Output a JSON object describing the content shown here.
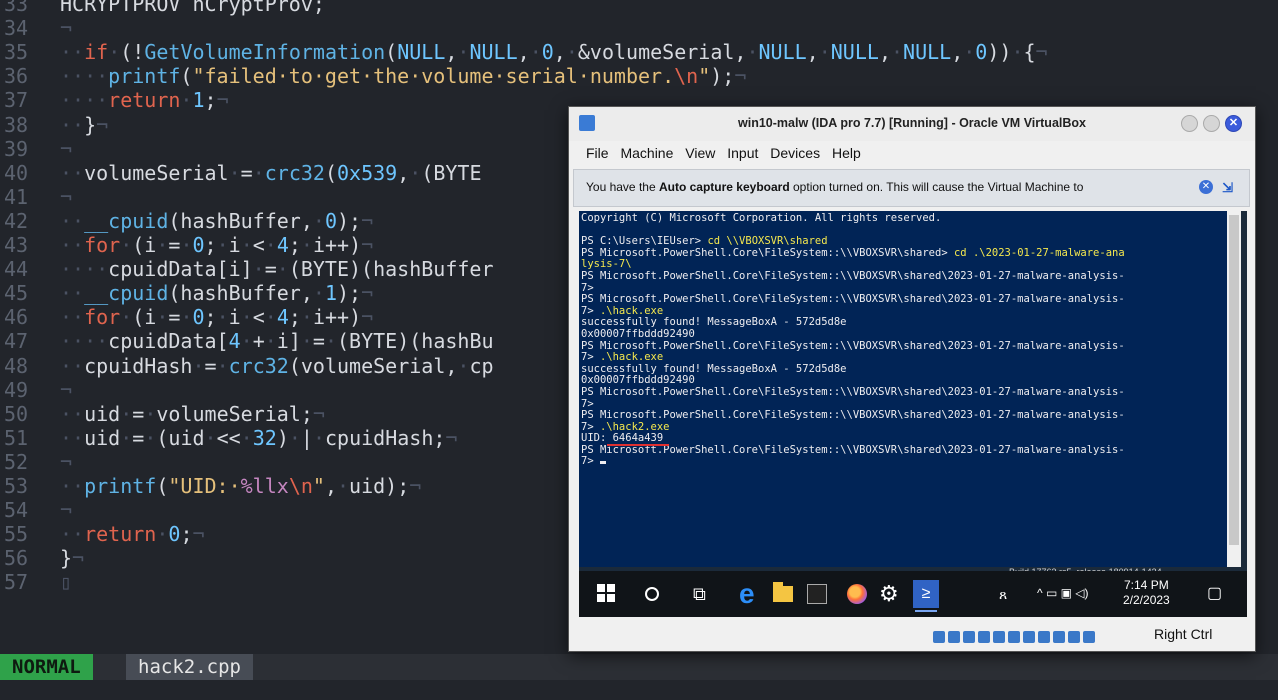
{
  "editor": {
    "lines": [
      {
        "num": "33",
        "html": "HCRYPTPROV hCryptProv;"
      },
      {
        "num": "34",
        "html": "<span class='w'>¬</span>"
      },
      {
        "num": "35",
        "html": "<span class='w'>··</span><span class='k'>if</span><span class='w'>·</span>(!<span class='f'>GetVolumeInformation</span>(<span class='n'>NULL</span>,<span class='w'>·</span><span class='n'>NULL</span>,<span class='w'>·</span><span class='n'>0</span>,<span class='w'>·</span>&volumeSerial,<span class='w'>·</span><span class='n'>NULL</span>,<span class='w'>·</span><span class='n'>NULL</span>,<span class='w'>·</span><span class='n'>NULL</span>,<span class='w'>·</span><span class='n'>0</span>))<span class='w'>·</span>{<span class='w'>¬</span>"
      },
      {
        "num": "36",
        "html": "<span class='w'>····</span><span class='f'>printf</span>(<span class='s'>\"failed·to·get·the·volume·serial·number.</span><span class='k'>\\n</span><span class='s'>\"</span>);<span class='w'>¬</span>"
      },
      {
        "num": "37",
        "html": "<span class='w'>····</span><span class='k'>return</span><span class='w'>·</span><span class='n'>1</span>;<span class='w'>¬</span>"
      },
      {
        "num": "38",
        "html": "<span class='w'>··</span>}<span class='w'>¬</span>"
      },
      {
        "num": "39",
        "html": "<span class='w'>¬</span>"
      },
      {
        "num": "40",
        "html": "<span class='w'>··</span>volumeSerial<span class='w'>·</span>=<span class='w'>·</span><span class='f'>crc32</span>(<span class='n'>0x539</span>,<span class='w'>·</span>(BYTE"
      },
      {
        "num": "41",
        "html": "<span class='w'>¬</span>"
      },
      {
        "num": "42",
        "html": "<span class='w'>··</span><span class='f'>__cpuid</span>(hashBuffer,<span class='w'>·</span><span class='n'>0</span>);<span class='w'>¬</span>"
      },
      {
        "num": "43",
        "html": "<span class='w'>··</span><span class='k'>for</span><span class='w'>·</span>(i<span class='w'>·</span>=<span class='w'>·</span><span class='n'>0</span>;<span class='w'>·</span>i<span class='w'>·</span>&lt;<span class='w'>·</span><span class='n'>4</span>;<span class='w'>·</span>i++)<span class='w'>¬</span>"
      },
      {
        "num": "44",
        "html": "<span class='w'>····</span>cpuidData[i]<span class='w'>·</span>=<span class='w'>·</span>(BYTE)(hashBuffer"
      },
      {
        "num": "45",
        "html": "<span class='w'>··</span><span class='f'>__cpuid</span>(hashBuffer,<span class='w'>·</span><span class='n'>1</span>);<span class='w'>¬</span>"
      },
      {
        "num": "46",
        "html": "<span class='w'>··</span><span class='k'>for</span><span class='w'>·</span>(i<span class='w'>·</span>=<span class='w'>·</span><span class='n'>0</span>;<span class='w'>·</span>i<span class='w'>·</span>&lt;<span class='w'>·</span><span class='n'>4</span>;<span class='w'>·</span>i++)<span class='w'>¬</span>"
      },
      {
        "num": "47",
        "html": "<span class='w'>····</span>cpuidData[<span class='n'>4</span><span class='w'>·</span>+<span class='w'>·</span>i]<span class='w'>·</span>=<span class='w'>·</span>(BYTE)(hashBu"
      },
      {
        "num": "48",
        "html": "<span class='w'>··</span>cpuidHash<span class='w'>·</span>=<span class='w'>·</span><span class='f'>crc32</span>(volumeSerial,<span class='w'>·</span>cp"
      },
      {
        "num": "49",
        "html": "<span class='w'>¬</span>"
      },
      {
        "num": "50",
        "html": "<span class='w'>··</span>uid<span class='w'>·</span>=<span class='w'>·</span>volumeSerial;<span class='w'>¬</span>"
      },
      {
        "num": "51",
        "html": "<span class='w'>··</span>uid<span class='w'>·</span>=<span class='w'>·</span>(uid<span class='w'>·</span>&lt;&lt;<span class='w'>·</span><span class='n'>32</span>)<span class='w'>·</span>|<span class='w'>·</span>cpuidHash;<span class='w'>¬</span>"
      },
      {
        "num": "52",
        "html": "<span class='w'>¬</span>"
      },
      {
        "num": "53",
        "html": "<span class='w'>··</span><span class='f'>printf</span>(<span class='s'>\"UID:·</span><span class='pu'>%llx</span><span class='k'>\\n</span><span class='s'>\"</span>,<span class='w'>·</span>uid);<span class='w'>¬</span>"
      },
      {
        "num": "54",
        "html": "<span class='w'>¬</span>"
      },
      {
        "num": "55",
        "html": "<span class='w'>··</span><span class='k'>return</span><span class='w'>·</span><span class='n'>0</span>;<span class='w'>¬</span>"
      },
      {
        "num": "56",
        "html": "}<span class='w'>¬</span>"
      },
      {
        "num": "57",
        "html": "<span class='w'>▯</span>"
      }
    ],
    "mode": "NORMAL",
    "filename": "hack2.cpp"
  },
  "vbox": {
    "title": "win10-malw (IDA pro 7.7) [Running] - Oracle VM VirtualBox",
    "menu": [
      "File",
      "Machine",
      "View",
      "Input",
      "Devices",
      "Help"
    ],
    "notice_pre": "You have the ",
    "notice_bold": "Auto capture keyboard",
    "notice_post": " option turned on. This will cause the Virtual Machine to",
    "host_key": "Right Ctrl"
  },
  "powershell": {
    "lines": [
      "Copyright (C) Microsoft Corporation. All rights reserved.",
      "",
      "PS C:\\Users\\IEUser> <y>cd \\\\VBOXSVR\\shared</y>",
      "PS Microsoft.PowerShell.Core\\FileSystem::\\\\VBOXSVR\\shared> <y>cd .\\2023-01-27-malware-ana</y>",
      "<y>lysis-7\\</y>",
      "PS Microsoft.PowerShell.Core\\FileSystem::\\\\VBOXSVR\\shared\\2023-01-27-malware-analysis-",
      "7>",
      "PS Microsoft.PowerShell.Core\\FileSystem::\\\\VBOXSVR\\shared\\2023-01-27-malware-analysis-",
      "7> <y>.\\hack.exe</y>",
      "successfully found! MessageBoxA - 572d5d8e",
      "0x00007ffbddd92490",
      "PS Microsoft.PowerShell.Core\\FileSystem::\\\\VBOXSVR\\shared\\2023-01-27-malware-analysis-",
      "7> <y>.\\hack.exe</y>",
      "successfully found! MessageBoxA - 572d5d8e",
      "0x00007ffbddd92490",
      "PS Microsoft.PowerShell.Core\\FileSystem::\\\\VBOXSVR\\shared\\2023-01-27-malware-analysis-",
      "7>",
      "PS Microsoft.PowerShell.Core\\FileSystem::\\\\VBOXSVR\\shared\\2023-01-27-malware-analysis-",
      "7> <y>.\\hack2.exe</y>",
      "UID: <u>6464a439</u>",
      "PS Microsoft.PowerShell.Core\\FileSystem::\\\\VBOXSVR\\shared\\2023-01-27-malware-analysis-",
      "7> <c></c>"
    ]
  },
  "taskbar": {
    "time": "7:14 PM",
    "date": "2/2/2023",
    "build_text": "Build 17763.rs5_release.180914-1434"
  },
  "colors": {
    "editor_bg": "#22252b",
    "keyword": "#e0644e",
    "function": "#5fb3e5",
    "string": "#e5c07b",
    "number": "#6ec6ff",
    "mode_bg": "#2fa24a",
    "ps_bg": "#012456"
  }
}
